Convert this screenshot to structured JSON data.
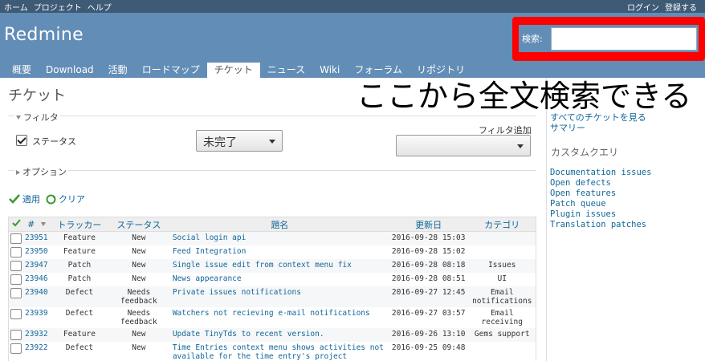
{
  "top_menu": {
    "home": "ホーム",
    "projects": "プロジェクト",
    "help": "ヘルプ",
    "login": "ログイン",
    "register": "登録する"
  },
  "header": {
    "title": "Redmine",
    "search_label": "検索:",
    "search_value": ""
  },
  "tabs": [
    "概要",
    "Download",
    "活動",
    "ロードマップ",
    "チケット",
    "ニュース",
    "Wiki",
    "フォーラム",
    "リポジトリ"
  ],
  "selected_tab": "チケット",
  "page_title": "チケット",
  "annotation": "ここから全文検索できる",
  "filters": {
    "legend": "フィルタ",
    "status_label": "ステータス",
    "status_value": "未完了",
    "add_filter_label": "フィルタ追加",
    "add_filter_value": "",
    "options_legend": "オプション"
  },
  "actions": {
    "apply": "適用",
    "clear": "クリア"
  },
  "table": {
    "headers": {
      "id": "#",
      "tracker": "トラッカー",
      "status": "ステータス",
      "subject": "題名",
      "updated": "更新日",
      "category": "カテゴリ"
    },
    "rows": [
      {
        "id": "23951",
        "tracker": "Feature",
        "status": "New",
        "subject": "Social login api",
        "updated": "2016-09-28 15:03",
        "category": ""
      },
      {
        "id": "23950",
        "tracker": "Feature",
        "status": "New",
        "subject": "Feed Integration",
        "updated": "2016-09-28 15:02",
        "category": ""
      },
      {
        "id": "23947",
        "tracker": "Patch",
        "status": "New",
        "subject": "Single issue edit from context menu fix",
        "updated": "2016-09-28 08:18",
        "category": "Issues"
      },
      {
        "id": "23946",
        "tracker": "Patch",
        "status": "New",
        "subject": "News appearance",
        "updated": "2016-09-28 08:51",
        "category": "UI"
      },
      {
        "id": "23940",
        "tracker": "Defect",
        "status": "Needs feedback",
        "subject": "Private issues notifications",
        "updated": "2016-09-27 12:45",
        "category": "Email notifications"
      },
      {
        "id": "23939",
        "tracker": "Defect",
        "status": "Needs feedback",
        "subject": "Watchers not recieving e-mail notifications",
        "updated": "2016-09-27 03:57",
        "category": "Email receiving"
      },
      {
        "id": "23932",
        "tracker": "Feature",
        "status": "New",
        "subject": "Update TinyTds to recent version.",
        "updated": "2016-09-26 13:10",
        "category": "Gems support"
      },
      {
        "id": "23922",
        "tracker": "Defect",
        "status": "New",
        "subject": "Time Entries context menu shows activities not available for the time entry's project",
        "updated": "2016-09-25 09:48",
        "category": ""
      }
    ]
  },
  "sidebar": {
    "view_all": "すべてのチケットを見る",
    "summary": "サマリー",
    "custom_queries_heading": "カスタムクエリ",
    "queries": [
      "Documentation issues",
      "Open defects",
      "Open features",
      "Patch queue",
      "Plugin issues",
      "Translation patches"
    ]
  },
  "colors": {
    "header_bg": "#628db6",
    "top_menu_bg": "#3e5b76",
    "highlight": "#ff0000",
    "link": "#116699"
  }
}
